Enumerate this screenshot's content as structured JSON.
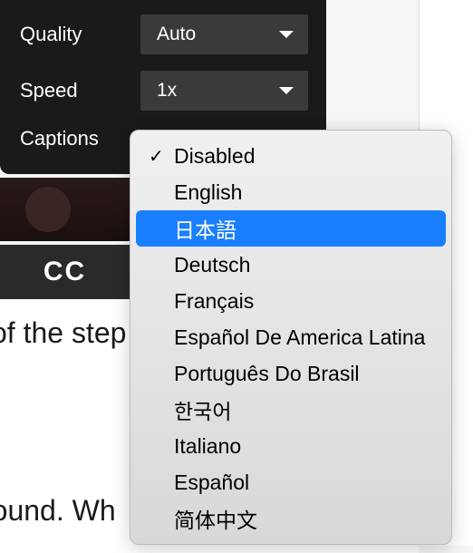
{
  "settings": {
    "quality": {
      "label": "Quality",
      "value": "Auto"
    },
    "speed": {
      "label": "Speed",
      "value": "1x"
    },
    "captions": {
      "label": "Captions"
    }
  },
  "cc_badge": "CC",
  "captions_menu": {
    "selected_index": 0,
    "highlighted_index": 2,
    "items": [
      "Disabled",
      "English",
      "日本語",
      "Deutsch",
      "Français",
      "Español De America Latina",
      "Português Do Brasil",
      "한국어",
      "Italiano",
      "Español",
      "简体中文"
    ]
  },
  "background_text": {
    "line1": "of the step",
    "line2": "round. Wh"
  }
}
